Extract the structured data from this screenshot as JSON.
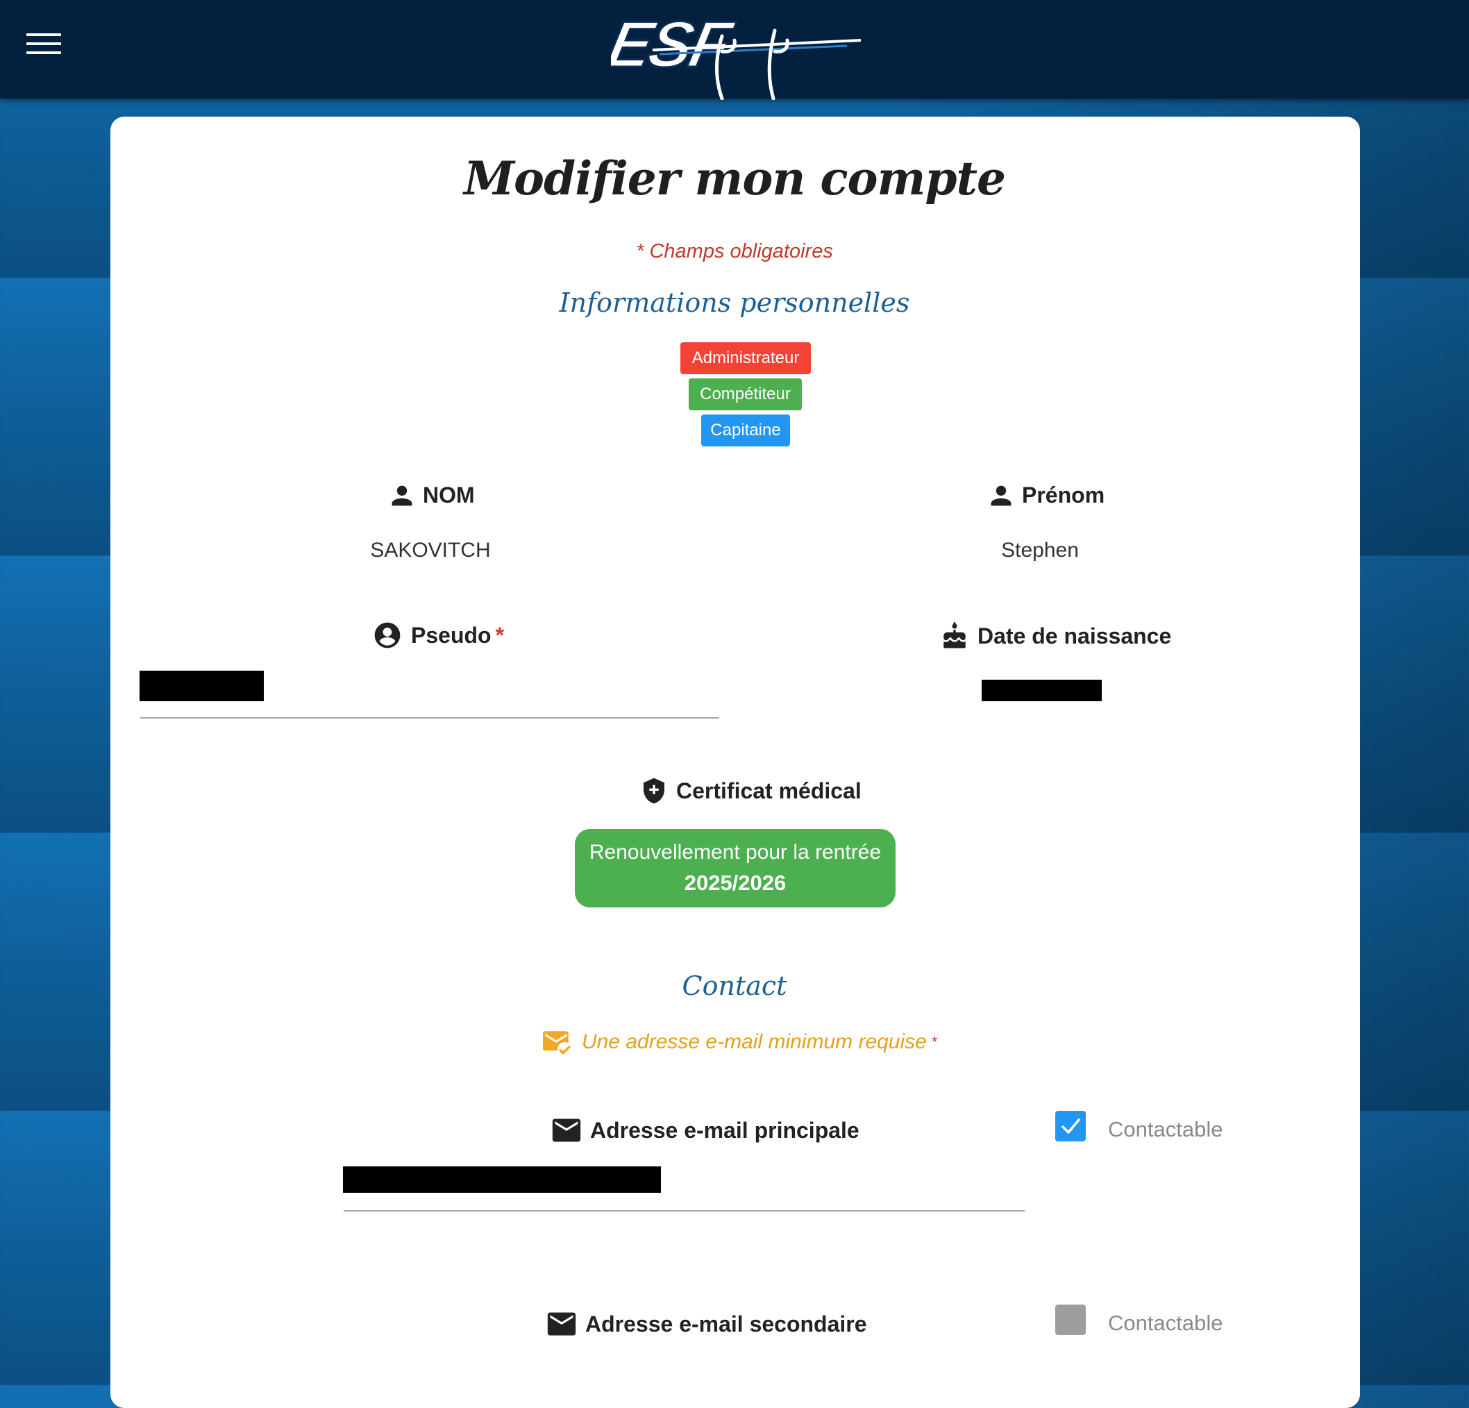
{
  "header": {
    "menu_icon": "hamburger-menu-icon",
    "logo_text": "ESF"
  },
  "page": {
    "title": "Modifier mon compte",
    "required_note": "* Champs obligatoires"
  },
  "personal": {
    "section_title": "Informations personnelles",
    "badges": [
      {
        "label": "Administrateur",
        "color": "#f44336"
      },
      {
        "label": "Compétiteur",
        "color": "#4caf50"
      },
      {
        "label": "Capitaine",
        "color": "#2196f3"
      }
    ],
    "nom_label": "NOM",
    "nom_value": "SAKOVITCH",
    "prenom_label": "Prénom",
    "prenom_value": "Stephen",
    "pseudo_label": "Pseudo",
    "required_star": "*",
    "birthdate_label": "Date de naissance",
    "certificate_label": "Certificat médical",
    "certificate_button_line1": "Renouvellement pour la rentrée",
    "certificate_button_line2": "2025/2026"
  },
  "contact": {
    "section_title": "Contact",
    "email_note": "Une adresse e-mail minimum requise",
    "primary_email_label": "Adresse e-mail principale",
    "primary_contactable_label": "Contactable",
    "primary_contactable_checked": true,
    "secondary_email_label": "Adresse e-mail secondaire",
    "secondary_contactable_label": "Contactable",
    "secondary_contactable_checked": false
  },
  "colors": {
    "header_bg": "#04203f",
    "accent_blue": "#1d5f95",
    "required_red": "#c0392b",
    "warning_orange": "#e5a01b",
    "checkbox_checked": "#2196f3",
    "checkbox_unchecked": "#9e9e9e"
  }
}
